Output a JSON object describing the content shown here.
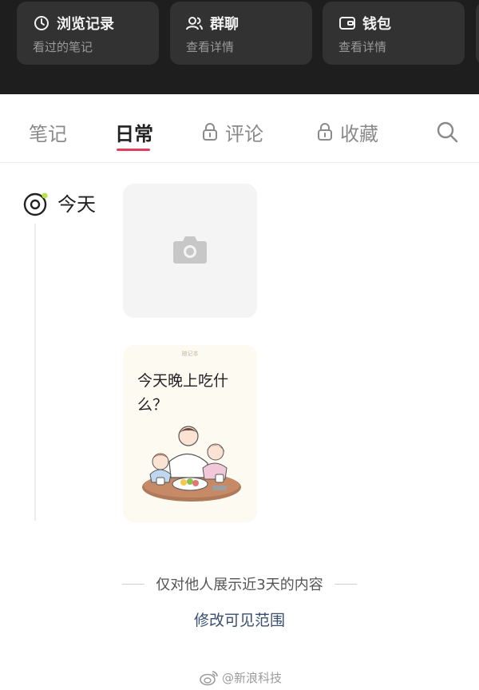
{
  "cards": [
    {
      "title": "浏览记录",
      "subtitle": "看过的笔记",
      "icon": "clock-icon"
    },
    {
      "title": "群聊",
      "subtitle": "查看详情",
      "icon": "people-icon"
    },
    {
      "title": "钱包",
      "subtitle": "查看详情",
      "icon": "wallet-icon"
    }
  ],
  "tabs": {
    "notes": "笔记",
    "daily": "日常",
    "comments": "评论",
    "favorites": "收藏"
  },
  "timeline": {
    "today_label": "今天",
    "note_tag": "随记本",
    "note_text": "今天晚上吃什么？"
  },
  "notice": {
    "text": "仅对他人展示近3天的内容",
    "link": "修改可见范围"
  },
  "watermark": "@新浪科技",
  "colors": {
    "accent": "#e0405a",
    "dark_bg": "#1e1e1e",
    "card_bg": "#323232",
    "link": "#3a4e70"
  }
}
